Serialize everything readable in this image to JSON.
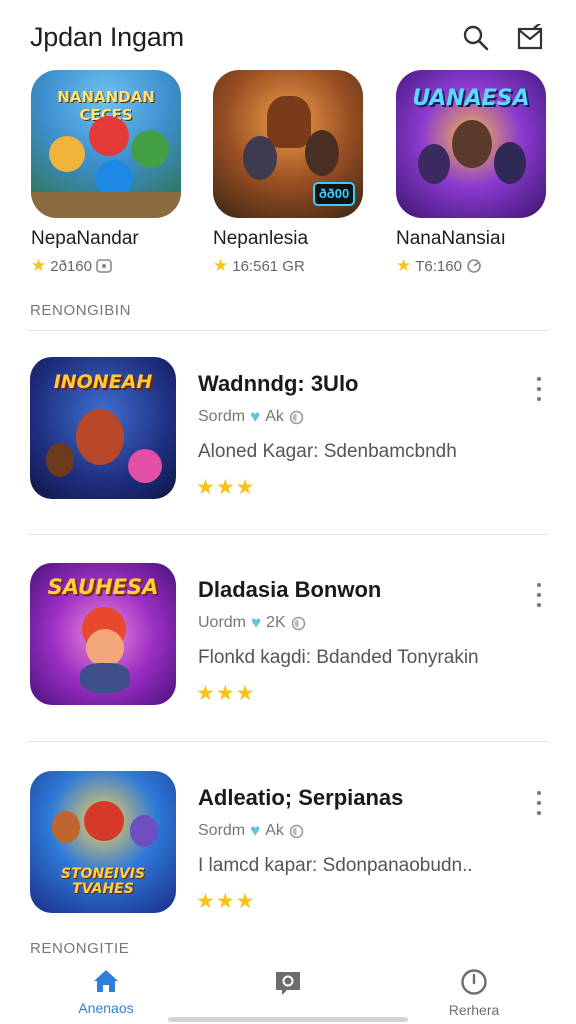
{
  "header": {
    "title": "Jpdan Ingam",
    "search_icon": "search-icon",
    "mail_icon": "mail-edit-icon"
  },
  "featured": [
    {
      "name": "NepaNandar",
      "rating": "2ð160",
      "extra_icon": "device-icon",
      "art_text": "NANANDAN CECES"
    },
    {
      "name": "Nepanlesia",
      "rating": "16:561 GR",
      "art_text": "ðð00"
    },
    {
      "name": "NanaNansiaı",
      "rating": "T6:160",
      "extra_icon": "settings-icon",
      "art_text": "UANAESA"
    }
  ],
  "sections": [
    {
      "label": "RENONGIBIN"
    },
    {
      "label": "RENONGITIE"
    }
  ],
  "list": [
    {
      "title": "Wadnndg: 3Ulo",
      "publisher": "Sordm",
      "tag": "Ak",
      "desc": "Aloned Kagar: Sdenbamcbndh",
      "stars": "★★★",
      "art_text": "INONEAH"
    },
    {
      "title": "Dladasia Bonwon",
      "publisher": "Uordm",
      "tag": "2K",
      "desc": "Flonkd kagdi: Bdanded Tonyrakin",
      "stars": "★★★",
      "art_text": "SAUHESA"
    },
    {
      "title": "Adleatio; Serpianas",
      "publisher": "Sordm",
      "tag": "Ak",
      "desc": "I lamcd kapar: Sdonpanaobudn..",
      "stars": "★★★",
      "art_text": "STONEIVIS TVAHES"
    }
  ],
  "bottom_nav": [
    {
      "label": "Anenaos",
      "icon": "home-icon",
      "active": true
    },
    {
      "label": "",
      "icon": "chat-icon",
      "active": false
    },
    {
      "label": "Rerhera",
      "icon": "clock-icon",
      "active": false
    }
  ],
  "colors": {
    "accent": "#2f7fd7",
    "star": "#f7c21a",
    "heart": "#66c2e0"
  }
}
